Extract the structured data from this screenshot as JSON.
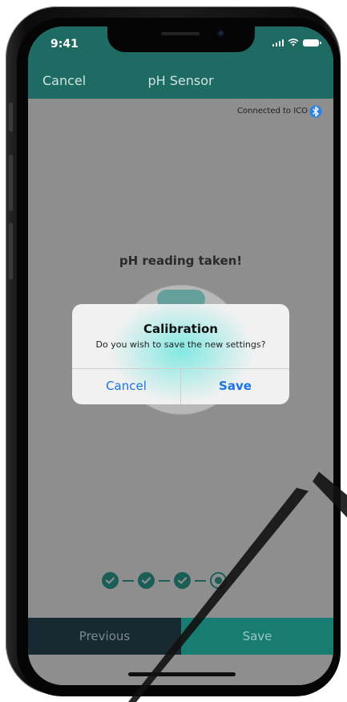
{
  "status_bar": {
    "time": "9:41"
  },
  "nav": {
    "cancel_label": "Cancel",
    "title": "pH Sensor"
  },
  "connection": {
    "text": "Connected to ICO",
    "icon": "bluetooth-icon"
  },
  "main": {
    "reading_text": "pH reading taken!"
  },
  "dialog": {
    "title": "Calibration",
    "message": "Do you wish to save the new settings?",
    "cancel_label": "Cancel",
    "save_label": "Save"
  },
  "steps": {
    "total": 4,
    "completed": 3,
    "current": 4
  },
  "bottom": {
    "previous_label": "Previous",
    "save_label": "Save"
  },
  "colors": {
    "brand": "#1e6b63",
    "dialog_button": "#1a73e8",
    "previous_bg": "#172a32",
    "save_bg": "#197c73",
    "bluetooth": "#2a82e4"
  }
}
